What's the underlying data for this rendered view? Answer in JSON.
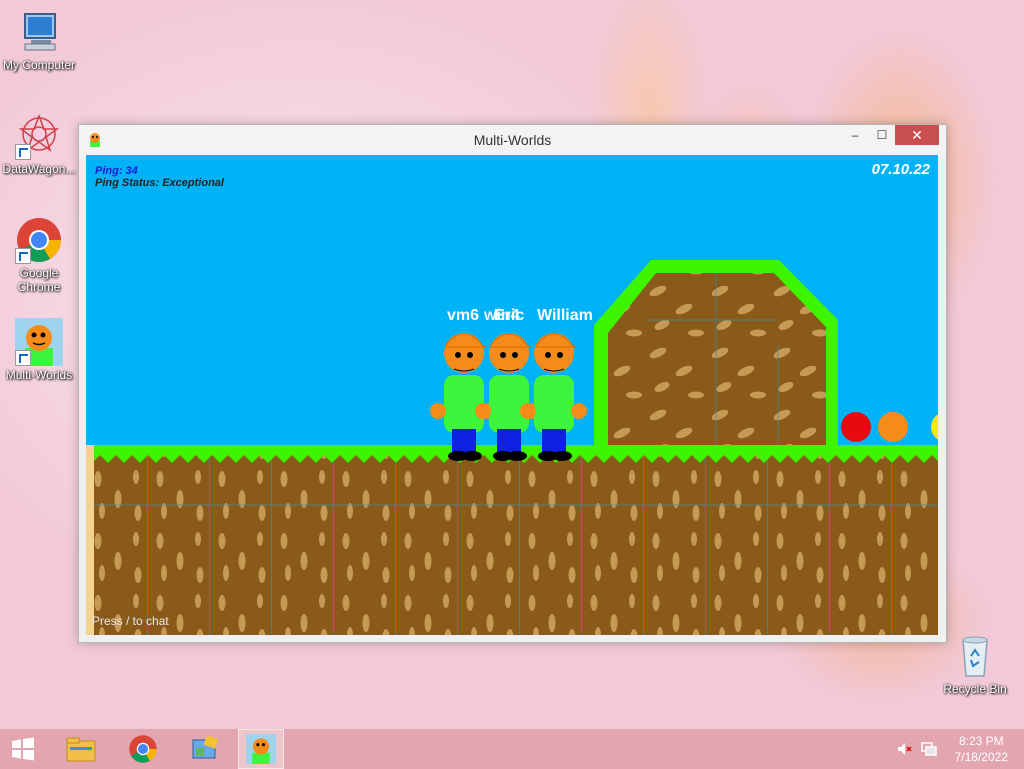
{
  "desktop": {
    "icons": [
      {
        "label": "My Computer",
        "icon": "computer-icon"
      },
      {
        "label": "DataWagon...",
        "icon": "datawagon-icon"
      },
      {
        "label": "Google Chrome",
        "icon": "chrome-icon"
      },
      {
        "label": "Multi-Worlds",
        "icon": "multiworlds-icon"
      },
      {
        "label": "Recycle Bin",
        "icon": "recycle-bin-icon"
      }
    ]
  },
  "window": {
    "title": "Multi-Worlds",
    "controls": {
      "minimize": "‒",
      "maximize": "☐",
      "close": "✕"
    }
  },
  "game": {
    "ping": "Ping: 34",
    "ping_status": "Ping Status: Exceptional",
    "date": "07.10.22",
    "chat_hint": "Press / to chat",
    "players": [
      {
        "name": "vm6"
      },
      {
        "name": "win4"
      },
      {
        "name": "Eric"
      },
      {
        "name": "William"
      }
    ],
    "colors": {
      "sky": "#00b3f7",
      "grass": "#3ef500",
      "dirt": "#8a5a1a",
      "shirt": "#3ef53e",
      "pants": "#1020e0",
      "head": "#f58c1a"
    }
  },
  "taskbar": {
    "items": [
      {
        "icon": "windows-start-icon"
      },
      {
        "icon": "file-explorer-icon"
      },
      {
        "icon": "chrome-icon"
      },
      {
        "icon": "app-icon"
      },
      {
        "icon": "multiworlds-icon",
        "active": true
      }
    ],
    "tray": {
      "volume": "muted",
      "network": "network-icon"
    },
    "time": "8:23 PM",
    "date": "7/18/2022"
  }
}
